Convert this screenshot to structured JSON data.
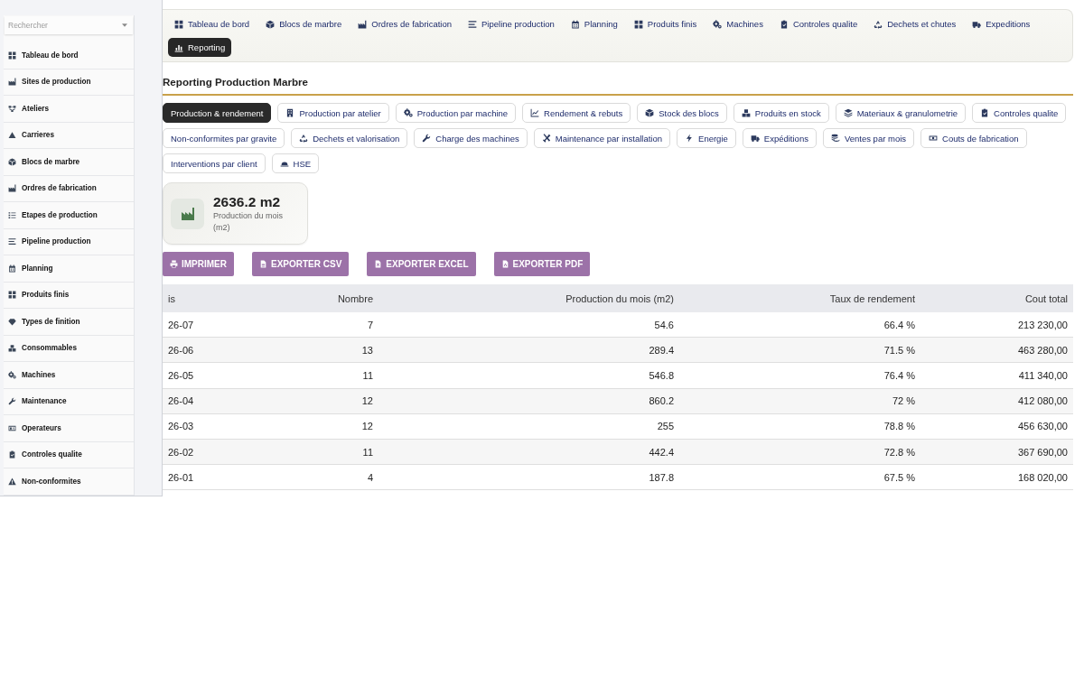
{
  "sidebar": {
    "search": {
      "placeholder": "Rechercher"
    },
    "items": [
      {
        "label": "Tableau de bord"
      },
      {
        "label": "Sites de production"
      },
      {
        "label": "Ateliers"
      },
      {
        "label": "Carrieres"
      },
      {
        "label": "Blocs de marbre"
      },
      {
        "label": "Ordres de fabrication"
      },
      {
        "label": "Etapes de production"
      },
      {
        "label": "Pipeline production"
      },
      {
        "label": "Planning"
      },
      {
        "label": "Produits finis"
      },
      {
        "label": "Types de finition"
      },
      {
        "label": "Consommables"
      },
      {
        "label": "Machines"
      },
      {
        "label": "Maintenance"
      },
      {
        "label": "Operateurs"
      },
      {
        "label": "Controles qualite"
      },
      {
        "label": "Non-conformites"
      }
    ]
  },
  "top_nav": {
    "items": [
      {
        "label": "Tableau de bord",
        "selected": false
      },
      {
        "label": "Blocs de marbre",
        "selected": false
      },
      {
        "label": "Ordres de fabrication",
        "selected": false
      },
      {
        "label": "Pipeline production",
        "selected": false
      },
      {
        "label": "Planning",
        "selected": false
      },
      {
        "label": "Produits finis",
        "selected": false
      },
      {
        "label": "Machines",
        "selected": false
      },
      {
        "label": "Controles qualite",
        "selected": false
      },
      {
        "label": "Dechets et chutes",
        "selected": false
      },
      {
        "label": "Expeditions",
        "selected": false
      },
      {
        "label": "Reporting",
        "selected": true
      }
    ]
  },
  "report": {
    "title": "Reporting Production Marbre",
    "tabs": [
      {
        "label": "Production & rendement",
        "selected": true
      },
      {
        "label": "Production par atelier",
        "selected": false
      },
      {
        "label": "Production par machine",
        "selected": false
      },
      {
        "label": "Rendement & rebuts",
        "selected": false
      },
      {
        "label": "Stock des blocs",
        "selected": false
      },
      {
        "label": "Produits en stock",
        "selected": false
      },
      {
        "label": "Materiaux & granulometrie",
        "selected": false
      },
      {
        "label": "Controles qualite",
        "selected": false
      },
      {
        "label": "Non-conformites par gravite",
        "selected": false
      },
      {
        "label": "Dechets et valorisation",
        "selected": false
      },
      {
        "label": "Charge des machines",
        "selected": false
      },
      {
        "label": "Maintenance par installation",
        "selected": false
      },
      {
        "label": "Energie",
        "selected": false
      },
      {
        "label": "Expéditions",
        "selected": false
      },
      {
        "label": "Ventes par mois",
        "selected": false
      },
      {
        "label": "Couts de fabrication",
        "selected": false
      },
      {
        "label": "Interventions par client",
        "selected": false
      },
      {
        "label": "HSE",
        "selected": false
      }
    ],
    "kpi": {
      "value": "2636.2 m2",
      "label": "Production du mois (m2)"
    },
    "actions": [
      "IMPRIMER",
      "EXPORTER CSV",
      "EXPORTER EXCEL",
      "EXPORTER PDF"
    ],
    "table": {
      "columns": [
        "is",
        "Nombre",
        "Production du mois (m2)",
        "Taux de rendement",
        "Cout total"
      ],
      "rows": [
        [
          "26-07",
          "7",
          "54.6",
          "66.4 %",
          "213 230,00"
        ],
        [
          "26-06",
          "13",
          "289.4",
          "71.5 %",
          "463 280,00"
        ],
        [
          "26-05",
          "11",
          "546.8",
          "76.4 %",
          "411 340,00"
        ],
        [
          "26-04",
          "12",
          "860.2",
          "72 %",
          "412 080,00"
        ],
        [
          "26-03",
          "12",
          "255",
          "78.8 %",
          "456 630,00"
        ],
        [
          "26-02",
          "11",
          "442.4",
          "72.8 %",
          "367 690,00"
        ],
        [
          "26-01",
          "4",
          "187.8",
          "67.5 %",
          "168 020,00"
        ]
      ]
    }
  }
}
